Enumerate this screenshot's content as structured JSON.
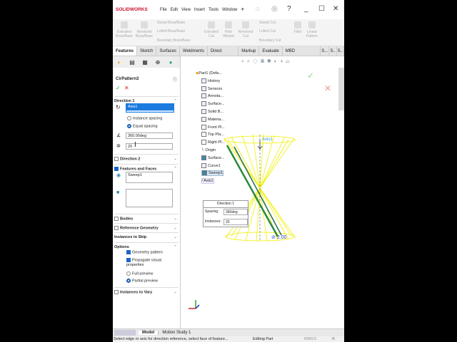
{
  "app": {
    "logo": "SOLIDWORKS",
    "menu": [
      "File",
      "Edit",
      "View",
      "Insert",
      "Tools",
      "Window"
    ]
  },
  "ribbon": {
    "items": [
      "Extruded Boss/Base",
      "Revolved Boss/Base",
      "Swept Boss/Base",
      "Lofted Boss/Base",
      "Boundary Boss/Base",
      "Extruded Cut",
      "Hole Wizard",
      "Revolved Cut",
      "Swept Cut",
      "Lofted Cut",
      "Boundary Cut",
      "Fillet",
      "Linear Pattern"
    ]
  },
  "tabs": [
    "Features",
    "Sketch",
    "Surfaces",
    "Weldments",
    "Direct Editing",
    "Markup",
    "Evaluate",
    "MBD Dimensions",
    "S...",
    "S..",
    "S..",
    "S.."
  ],
  "pm": {
    "title": "CirPattern3",
    "direction1": "Direction 1",
    "axis": "Axis1",
    "instance_spacing": "Instance spacing",
    "equal_spacing": "Equal spacing",
    "angle": "360.00deg",
    "instances": "20",
    "direction2": "Direction 2",
    "features_faces": "Features and Faces",
    "feature": "Sweep1",
    "bodies": "Bodies",
    "ref_geom": "Reference Geometry",
    "skip": "Instances to Skip",
    "options": "Options",
    "geom_pattern": "Geometry pattern",
    "propagate": "Propagate visual properties",
    "full_preview": "Full preview",
    "partial_preview": "Partial preview",
    "vary": "Instances to Vary"
  },
  "tree": [
    "Part1 (Defa...",
    "History",
    "Sensors",
    "Annota...",
    "Surface...",
    "Solid B...",
    "Materia...",
    "Front Pl...",
    "Top Pla...",
    "Right Pl...",
    "Origin",
    "Surface...",
    "Curve1",
    "Sweep1",
    "Axis1"
  ],
  "popup": {
    "title": "Direction 1",
    "spacing_label": "Spacing:",
    "spacing": "360deg",
    "instances_label": "Instances:",
    "instances": "20"
  },
  "graphics": {
    "axis_label": "Axis1",
    "dim": "2.00"
  },
  "bottom_tabs": [
    "Model",
    "Motion Study 1"
  ],
  "status": {
    "message": "Select edge or axis for direction reference, select face of feature...",
    "mode": "Editing Part",
    "units": "MMGS"
  }
}
